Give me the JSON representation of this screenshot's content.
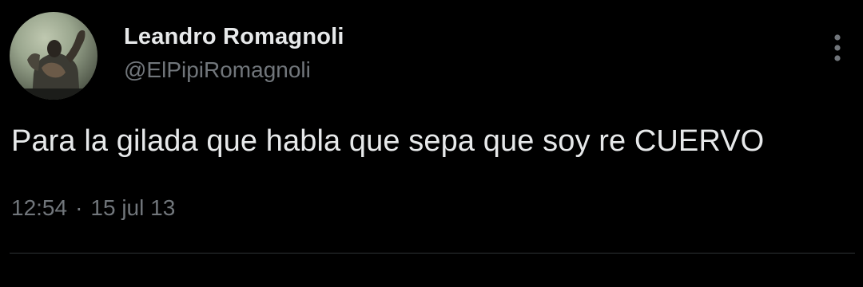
{
  "user": {
    "display_name": "Leandro Romagnoli",
    "handle": "@ElPipiRomagnoli",
    "avatar_icon": "profile-photo-icon"
  },
  "tweet": {
    "text": "Para la gilada que habla que sepa que soy re CUERVO",
    "time": "12:54",
    "separator": "·",
    "date": "15 jul 13"
  },
  "actions": {
    "more_icon": "more-vertical-icon"
  },
  "colors": {
    "background": "#000000",
    "primary_text": "#e7e9ea",
    "secondary_text": "#71767b",
    "divider": "#2f3336"
  }
}
